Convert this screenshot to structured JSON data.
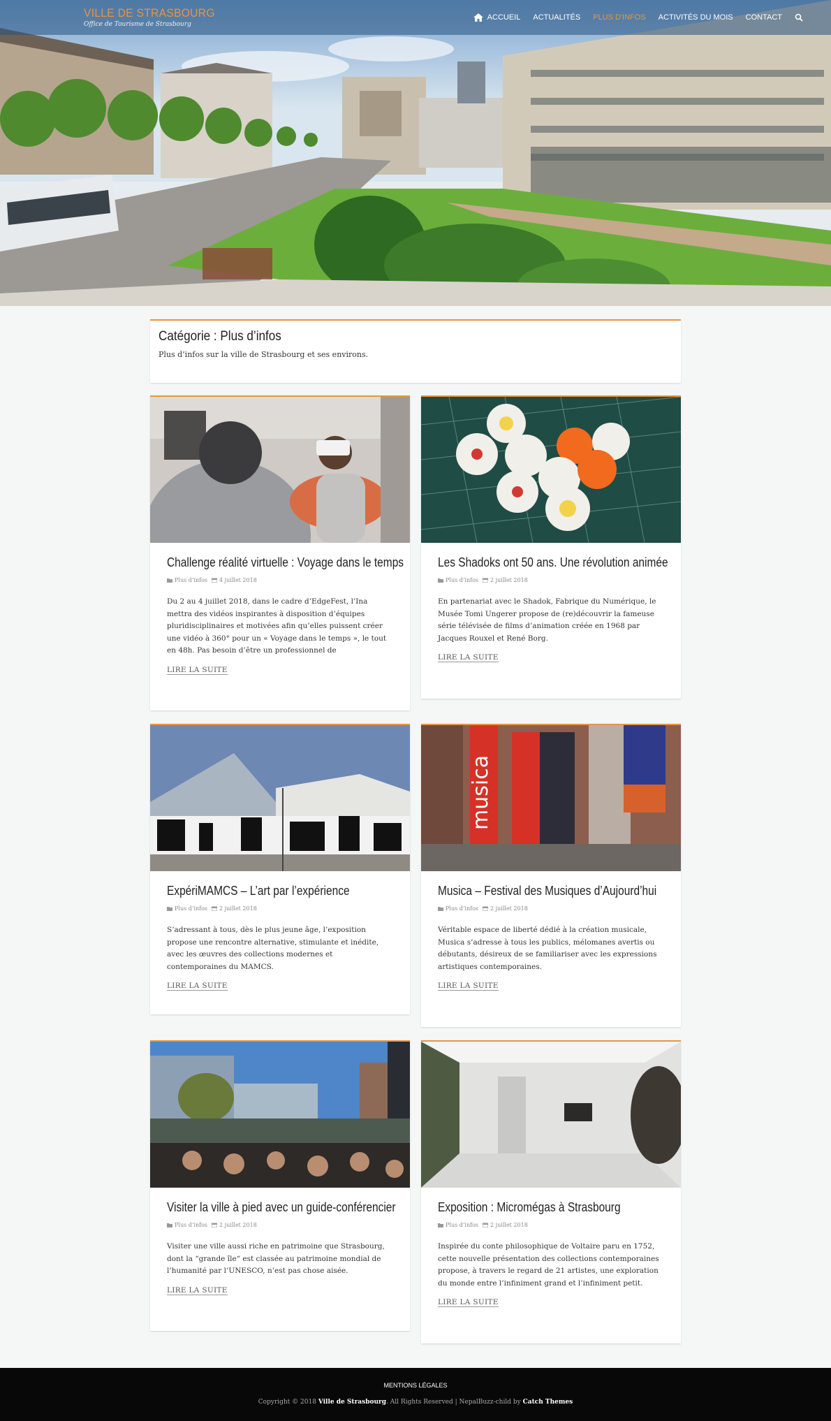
{
  "site": {
    "title": "VILLE DE STRASBOURG",
    "tagline": "Office de Tourisme de Strasbourg"
  },
  "nav": {
    "items": [
      {
        "label": "ACCUEIL",
        "icon": "home-icon"
      },
      {
        "label": "ACTUALITÉS"
      },
      {
        "label": "PLUS D'INFOS",
        "active": true
      },
      {
        "label": "ACTIVITÉS DU MOIS"
      },
      {
        "label": "CONTACT"
      }
    ],
    "search_icon": "search-icon"
  },
  "category": {
    "title": "Catégorie : Plus d’infos",
    "description": "Plus d’infos sur la ville de Strasbourg et ses environs."
  },
  "posts": [
    {
      "title": "Challenge réalité virtuelle : Voyage dans le temps",
      "category": "Plus d’infos",
      "date": "4 juillet 2018",
      "excerpt": "Du 2 au 4 juillet 2018, dans le cadre d’EdgeFest, l’Ina mettra des vidéos inspirantes à disposition d’équipes pluridisciplinaires et motivées afin qu’elles puissent créer une vidéo à 360° pour un « Voyage dans le temps », le tout en 48h. Pas besoin d’être un professionnel de",
      "read_more": "LIRE LA SUITE"
    },
    {
      "title": "Les Shadoks ont 50 ans. Une révolution animée",
      "category": "Plus d’infos",
      "date": "2 juillet 2018",
      "excerpt": "En partenariat avec le Shadok, Fabrique du Numérique, le Musée Tomi Ungerer propose de (re)découvrir la fameuse série télévisée de films d’animation créée en 1968 par Jacques Rouxel et René Borg.",
      "read_more": "LIRE LA SUITE"
    },
    {
      "title": "ExpériMAMCS – L’art par l’expérience",
      "category": "Plus d’infos",
      "date": "2 juillet 2018",
      "excerpt": "S’adressant à tous, dès le plus jeune âge, l’exposition propose une rencontre alternative, stimulante et inédite, avec les œuvres des collections modernes et contemporaines du MAMCS.",
      "read_more": "LIRE LA SUITE"
    },
    {
      "title": "Musica – Festival des Musiques d’Aujourd’hui",
      "category": "Plus d’infos",
      "date": "2 juillet 2018",
      "excerpt": "Véritable espace de liberté dédié à la création musicale, Musica s’adresse à tous les publics, mélomanes avertis ou débutants, dé­sireux de se familiariser avec les expressions artistiques contem­poraines.",
      "read_more": "LIRE LA SUITE"
    },
    {
      "title": "Visiter la ville à pied avec un guide-conférencier",
      "category": "Plus d’infos",
      "date": "2 juillet 2018",
      "excerpt": "Visiter une ville aussi riche en patrimoine que Strasbourg, dont la “grande île“ est classée au patrimoine mondial de l’humanité par l’UNESCO, n’est pas chose aisée.",
      "read_more": "LIRE LA SUITE"
    },
    {
      "title": "Exposition : Micromégas à Strasbourg",
      "category": "Plus d’infos",
      "date": "2 juillet 2018",
      "excerpt": "Inspirée du conte philosophique de Voltaire paru en 1752, cette nouvelle présentation des collections contemporaines propose, à travers le regard de 21 artistes, une exploration du monde entre l’infiniment grand et l’infiniment petit.",
      "read_more": "LIRE LA SUITE"
    }
  ],
  "footer": {
    "menu_link": "MENTIONS LÉGALES",
    "copyright_prefix": "Copyright © 2018",
    "site_name": "Ville de Strasbourg",
    "rights": ". All Rights Reserved | NepalBuzz-child by",
    "theme_author": "Catch Themes"
  },
  "colors": {
    "accent": "#e8953f",
    "nav_bg": "#2f5a86",
    "footer_bg": "#080808",
    "page_bg": "#f5f6f6"
  }
}
